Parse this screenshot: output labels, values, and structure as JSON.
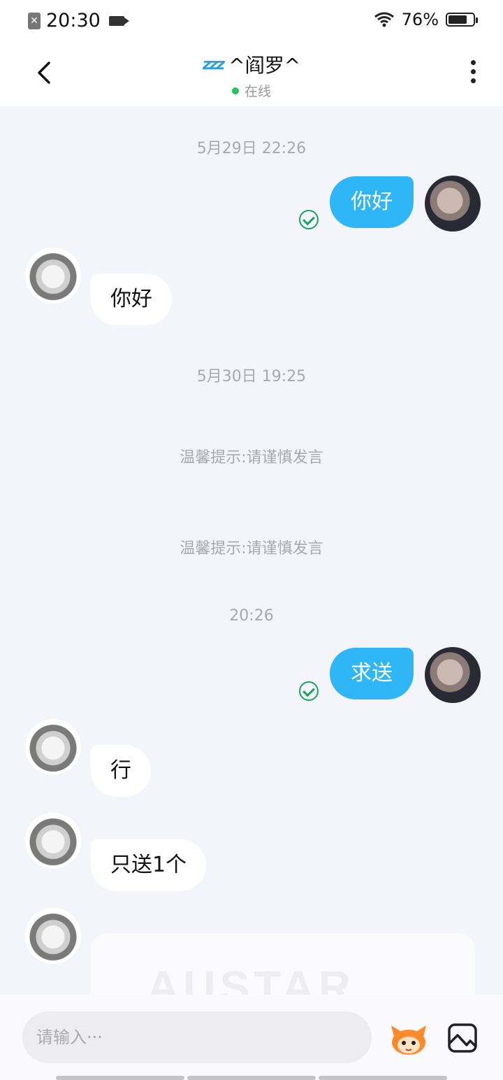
{
  "status_bar": {
    "time": "20:30",
    "battery_percent": "76%",
    "battery_level": 0.76
  },
  "header": {
    "title_name": "^阎罗^",
    "status": "在线",
    "status_color": "#23c45a"
  },
  "messages": [
    {
      "type": "timestamp",
      "text": "5月29日 22:26"
    },
    {
      "type": "outgoing",
      "text": "你好",
      "read": true
    },
    {
      "type": "incoming",
      "text": "你好"
    },
    {
      "type": "timestamp",
      "text": "5月30日 19:25"
    },
    {
      "type": "tip",
      "text": "温馨提示:请谨慎发言"
    },
    {
      "type": "tip",
      "text": "温馨提示:请谨慎发言"
    },
    {
      "type": "timestamp",
      "text": "20:26"
    },
    {
      "type": "outgoing",
      "text": "求送",
      "read": true
    },
    {
      "type": "incoming",
      "text": "行"
    },
    {
      "type": "incoming",
      "text": "只送1个"
    },
    {
      "type": "incoming",
      "text": ""
    }
  ],
  "input": {
    "placeholder": "请输入···"
  },
  "colors": {
    "outgoing_bubble": "#2eb6f7",
    "read_check": "#1ba35e",
    "background": "#f4f5fa"
  },
  "icons": [
    "back-icon",
    "more-icon",
    "sticker-icon",
    "image-icon",
    "read-check-icon"
  ]
}
